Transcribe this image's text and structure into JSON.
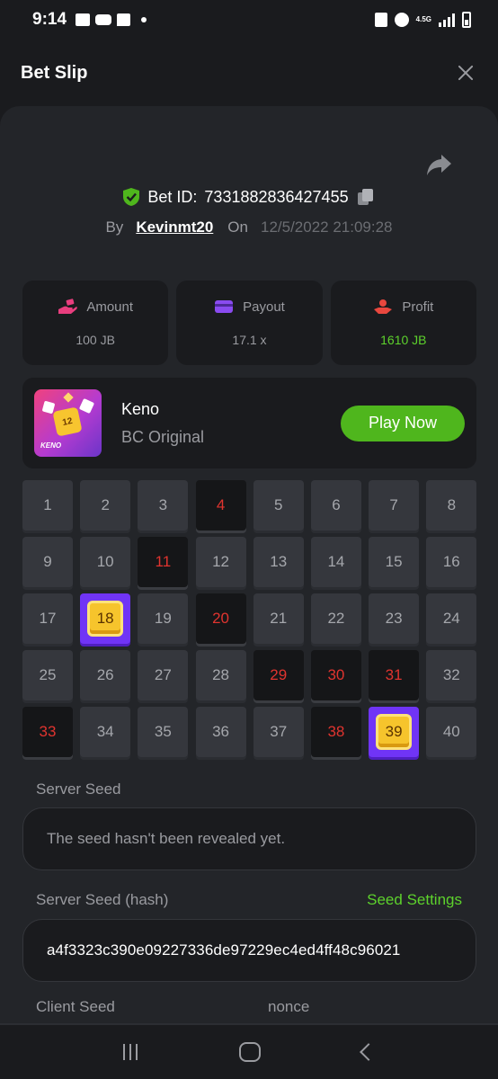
{
  "status_bar": {
    "time": "9:14",
    "network_label": "4.5G"
  },
  "header": {
    "title": "Bet Slip"
  },
  "bet": {
    "id_label": "Bet ID:",
    "id_value": "7331882836427455",
    "by_label": "By",
    "username": "Kevinmt20",
    "on_label": "On",
    "date": "12/5/2022 21:09:28"
  },
  "stats": [
    {
      "label": "Amount",
      "value": "100 JB",
      "icon": "money-hand-icon"
    },
    {
      "label": "Payout",
      "value": "17.1 x",
      "icon": "card-icon"
    },
    {
      "label": "Profit",
      "value": "1610 JB",
      "icon": "profit-hand-icon"
    }
  ],
  "game": {
    "name": "Keno",
    "subtitle": "BC Original",
    "thumb_label": "KENO",
    "thumb_number": "12",
    "play_label": "Play Now"
  },
  "keno": {
    "numbers": [
      "1",
      "2",
      "3",
      "4",
      "5",
      "6",
      "7",
      "8",
      "9",
      "10",
      "11",
      "12",
      "13",
      "14",
      "15",
      "16",
      "17",
      "18",
      "19",
      "20",
      "21",
      "22",
      "23",
      "24",
      "25",
      "26",
      "27",
      "28",
      "29",
      "30",
      "31",
      "32",
      "33",
      "34",
      "35",
      "36",
      "37",
      "38",
      "39",
      "40"
    ],
    "drawn_miss": [
      4,
      11,
      20,
      29,
      30,
      31,
      33,
      38
    ],
    "drawn_hit": [
      18,
      39
    ]
  },
  "seeds": {
    "server_seed_label": "Server Seed",
    "server_seed_value": "The seed hasn't been revealed yet.",
    "server_hash_label": "Server Seed (hash)",
    "seed_settings_label": "Seed Settings",
    "server_hash_value": "a4f3323c390e09227336de97229ec4ed4ff48c96021",
    "client_seed_label": "Client Seed",
    "nonce_label": "nonce"
  },
  "colors": {
    "accent_green": "#4fb61d",
    "miss_red": "#e0342f",
    "hit_purple": "#7034f6",
    "gem_gold": "#f6c42c"
  }
}
